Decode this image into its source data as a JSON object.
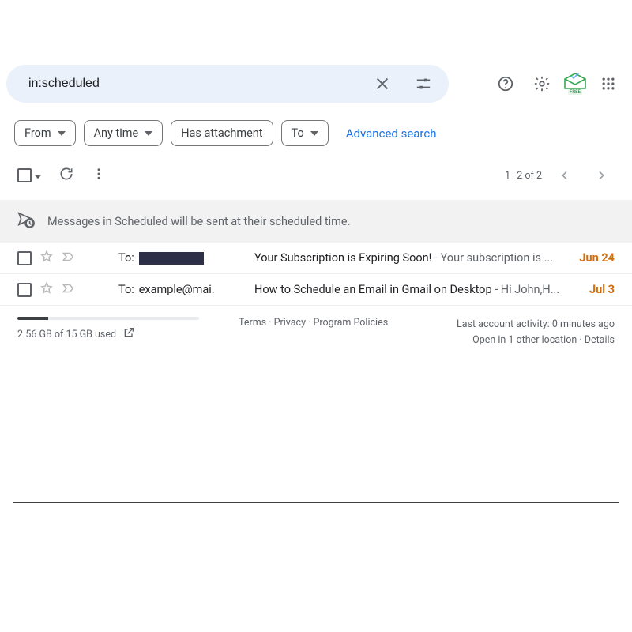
{
  "search": {
    "value": "in:scheduled"
  },
  "chips": {
    "from": "From",
    "anytime": "Any time",
    "attachment": "Has attachment",
    "to": "To",
    "advanced": "Advanced search"
  },
  "toolbar": {
    "page_count": "1–2 of 2"
  },
  "banner": {
    "text": "Messages in Scheduled will be sent at their scheduled time."
  },
  "rows": [
    {
      "to_prefix": "To: ",
      "to_redacted": true,
      "to_text": "",
      "subject": "Your Subscription is Expiring Soon!",
      "snippet": " - Your subscription is ...",
      "date": "Jun 24"
    },
    {
      "to_prefix": "To: ",
      "to_redacted": false,
      "to_text": "example@mai.",
      "subject": "How to Schedule an Email in Gmail on Desktop",
      "snippet": " - Hi John,H...",
      "date": "Jul 3"
    }
  ],
  "footer": {
    "storage_text": "2.56 GB of 15 GB used",
    "storage_percent": 17,
    "terms": "Terms",
    "privacy": "Privacy",
    "policies": "Program Policies",
    "activity": "Last account activity: 0 minutes ago",
    "open_other": "Open in 1 other location",
    "details": "Details"
  },
  "badge": {
    "free": "FREE"
  }
}
